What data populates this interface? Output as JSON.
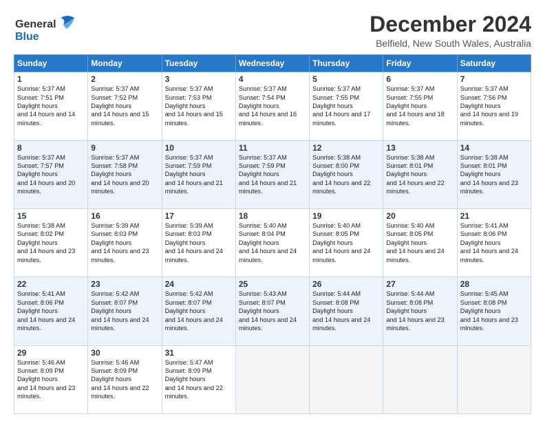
{
  "logo": {
    "line1": "General",
    "line2": "Blue"
  },
  "title": "December 2024",
  "location": "Belfield, New South Wales, Australia",
  "days_header": [
    "Sunday",
    "Monday",
    "Tuesday",
    "Wednesday",
    "Thursday",
    "Friday",
    "Saturday"
  ],
  "weeks": [
    [
      {
        "day": "1",
        "sunrise": "5:37 AM",
        "sunset": "7:51 PM",
        "daylight": "14 hours and 14 minutes."
      },
      {
        "day": "2",
        "sunrise": "5:37 AM",
        "sunset": "7:52 PM",
        "daylight": "14 hours and 15 minutes."
      },
      {
        "day": "3",
        "sunrise": "5:37 AM",
        "sunset": "7:53 PM",
        "daylight": "14 hours and 15 minutes."
      },
      {
        "day": "4",
        "sunrise": "5:37 AM",
        "sunset": "7:54 PM",
        "daylight": "14 hours and 16 minutes."
      },
      {
        "day": "5",
        "sunrise": "5:37 AM",
        "sunset": "7:55 PM",
        "daylight": "14 hours and 17 minutes."
      },
      {
        "day": "6",
        "sunrise": "5:37 AM",
        "sunset": "7:55 PM",
        "daylight": "14 hours and 18 minutes."
      },
      {
        "day": "7",
        "sunrise": "5:37 AM",
        "sunset": "7:56 PM",
        "daylight": "14 hours and 19 minutes."
      }
    ],
    [
      {
        "day": "8",
        "sunrise": "5:37 AM",
        "sunset": "7:57 PM",
        "daylight": "14 hours and 20 minutes."
      },
      {
        "day": "9",
        "sunrise": "5:37 AM",
        "sunset": "7:58 PM",
        "daylight": "14 hours and 20 minutes."
      },
      {
        "day": "10",
        "sunrise": "5:37 AM",
        "sunset": "7:59 PM",
        "daylight": "14 hours and 21 minutes."
      },
      {
        "day": "11",
        "sunrise": "5:37 AM",
        "sunset": "7:59 PM",
        "daylight": "14 hours and 21 minutes."
      },
      {
        "day": "12",
        "sunrise": "5:38 AM",
        "sunset": "8:00 PM",
        "daylight": "14 hours and 22 minutes."
      },
      {
        "day": "13",
        "sunrise": "5:38 AM",
        "sunset": "8:01 PM",
        "daylight": "14 hours and 22 minutes."
      },
      {
        "day": "14",
        "sunrise": "5:38 AM",
        "sunset": "8:01 PM",
        "daylight": "14 hours and 23 minutes."
      }
    ],
    [
      {
        "day": "15",
        "sunrise": "5:38 AM",
        "sunset": "8:02 PM",
        "daylight": "14 hours and 23 minutes."
      },
      {
        "day": "16",
        "sunrise": "5:39 AM",
        "sunset": "8:03 PM",
        "daylight": "14 hours and 23 minutes."
      },
      {
        "day": "17",
        "sunrise": "5:39 AM",
        "sunset": "8:03 PM",
        "daylight": "14 hours and 24 minutes."
      },
      {
        "day": "18",
        "sunrise": "5:40 AM",
        "sunset": "8:04 PM",
        "daylight": "14 hours and 24 minutes."
      },
      {
        "day": "19",
        "sunrise": "5:40 AM",
        "sunset": "8:05 PM",
        "daylight": "14 hours and 24 minutes."
      },
      {
        "day": "20",
        "sunrise": "5:40 AM",
        "sunset": "8:05 PM",
        "daylight": "14 hours and 24 minutes."
      },
      {
        "day": "21",
        "sunrise": "5:41 AM",
        "sunset": "8:06 PM",
        "daylight": "14 hours and 24 minutes."
      }
    ],
    [
      {
        "day": "22",
        "sunrise": "5:41 AM",
        "sunset": "8:06 PM",
        "daylight": "14 hours and 24 minutes."
      },
      {
        "day": "23",
        "sunrise": "5:42 AM",
        "sunset": "8:07 PM",
        "daylight": "14 hours and 24 minutes."
      },
      {
        "day": "24",
        "sunrise": "5:42 AM",
        "sunset": "8:07 PM",
        "daylight": "14 hours and 24 minutes."
      },
      {
        "day": "25",
        "sunrise": "5:43 AM",
        "sunset": "8:07 PM",
        "daylight": "14 hours and 24 minutes."
      },
      {
        "day": "26",
        "sunrise": "5:44 AM",
        "sunset": "8:08 PM",
        "daylight": "14 hours and 24 minutes."
      },
      {
        "day": "27",
        "sunrise": "5:44 AM",
        "sunset": "8:08 PM",
        "daylight": "14 hours and 23 minutes."
      },
      {
        "day": "28",
        "sunrise": "5:45 AM",
        "sunset": "8:08 PM",
        "daylight": "14 hours and 23 minutes."
      }
    ],
    [
      {
        "day": "29",
        "sunrise": "5:46 AM",
        "sunset": "8:09 PM",
        "daylight": "14 hours and 23 minutes."
      },
      {
        "day": "30",
        "sunrise": "5:46 AM",
        "sunset": "8:09 PM",
        "daylight": "14 hours and 22 minutes."
      },
      {
        "day": "31",
        "sunrise": "5:47 AM",
        "sunset": "8:09 PM",
        "daylight": "14 hours and 22 minutes."
      },
      null,
      null,
      null,
      null
    ]
  ]
}
